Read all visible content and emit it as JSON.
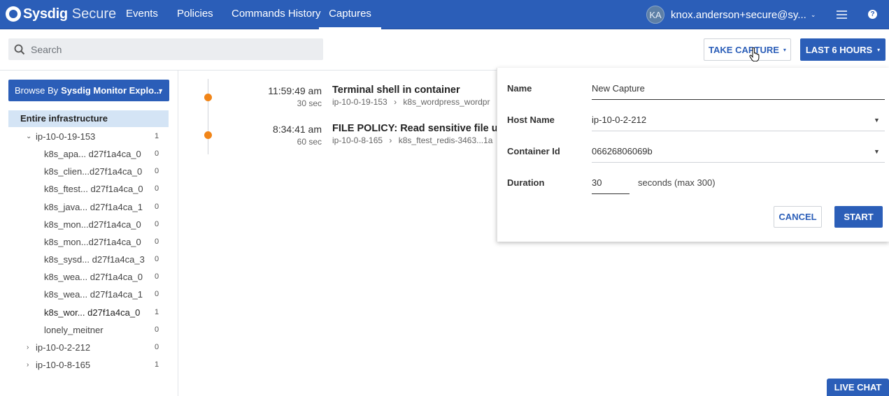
{
  "brand": {
    "name": "Sysdig",
    "product": "Secure"
  },
  "nav": {
    "items": [
      {
        "label": "Events"
      },
      {
        "label": "Policies"
      },
      {
        "label": "Commands History"
      },
      {
        "label": "Captures"
      }
    ],
    "active": "Captures"
  },
  "user": {
    "initials": "KA",
    "email": "knox.anderson+secure@sy..."
  },
  "search": {
    "placeholder": "Search",
    "value": ""
  },
  "toolbar": {
    "take_capture": "TAKE CAPTURE",
    "time_range": "LAST 6 HOURS"
  },
  "sidebar": {
    "browse_prefix": "Browse By",
    "browse_value": "Sysdig Monitor Explo...",
    "entire": "Entire infrastructure",
    "hosts": [
      {
        "name": "ip-10-0-19-153",
        "count": "1",
        "expanded": true,
        "containers": [
          {
            "label": "k8s_apa... d27f1a4ca_0",
            "count": "0"
          },
          {
            "label": "k8s_clien...d27f1a4ca_0",
            "count": "0"
          },
          {
            "label": "k8s_ftest... d27f1a4ca_0",
            "count": "0"
          },
          {
            "label": "k8s_java... d27f1a4ca_1",
            "count": "0"
          },
          {
            "label": "k8s_mon...d27f1a4ca_0",
            "count": "0"
          },
          {
            "label": "k8s_mon...d27f1a4ca_0",
            "count": "0"
          },
          {
            "label": "k8s_sysd... d27f1a4ca_3",
            "count": "0"
          },
          {
            "label": "k8s_wea... d27f1a4ca_0",
            "count": "0"
          },
          {
            "label": "k8s_wea... d27f1a4ca_1",
            "count": "0"
          },
          {
            "label": "k8s_wor... d27f1a4ca_0",
            "count": "1"
          },
          {
            "label": "lonely_meitner",
            "count": "0"
          }
        ]
      },
      {
        "name": "ip-10-0-2-212",
        "count": "0",
        "expanded": false
      },
      {
        "name": "ip-10-0-8-165",
        "count": "1",
        "expanded": false
      }
    ]
  },
  "events": [
    {
      "time": "11:59:49 am",
      "duration": "30 sec",
      "title": "Terminal shell in container",
      "host": "ip-10-0-19-153",
      "container": "k8s_wordpress_wordpr"
    },
    {
      "time": "8:34:41 am",
      "duration": "60 sec",
      "title": "FILE POLICY: Read sensitive file un",
      "host": "ip-10-0-8-165",
      "container": "k8s_ftest_redis-3463...1a"
    }
  ],
  "capture_form": {
    "name_label": "Name",
    "name_value": "New Capture",
    "host_label": "Host Name",
    "host_value": "ip-10-0-2-212",
    "container_label": "Container Id",
    "container_value": "06626806069b",
    "duration_label": "Duration",
    "duration_value": "30",
    "duration_note": "seconds (max 300)",
    "cancel": "CANCEL",
    "start": "START"
  },
  "live_chat": "LIVE CHAT",
  "colors": {
    "primary": "#2b5eb8",
    "selection": "#d4e4f5",
    "event_dot": "#f18518"
  }
}
